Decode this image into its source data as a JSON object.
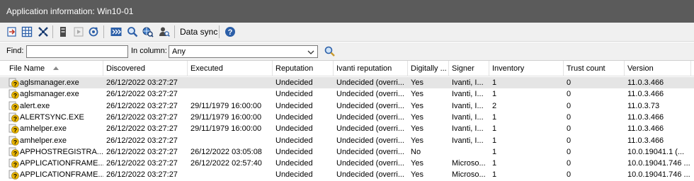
{
  "window": {
    "title": "Application information: Win10-01"
  },
  "toolbar": {
    "buttons": [
      {
        "icon": "export-icon"
      },
      {
        "icon": "grid-icon"
      },
      {
        "icon": "expand-icon"
      },
      {
        "icon": "device-icon"
      },
      {
        "icon": "play-icon"
      },
      {
        "icon": "refresh-icon"
      },
      {
        "icon": "forward-icon"
      },
      {
        "icon": "search-web-icon"
      },
      {
        "icon": "globe-search-icon"
      },
      {
        "icon": "user-search-icon"
      },
      {
        "icon": "help-icon"
      }
    ],
    "data_sync_label": "Data sync"
  },
  "findbar": {
    "find_label": "Find:",
    "find_value": "",
    "in_column_label": "In column:",
    "in_column_value": "Any"
  },
  "columns": [
    "File Name",
    "Discovered",
    "Executed",
    "Reputation",
    "Ivanti reputation",
    "Digitally ...",
    "Signer",
    "Inventory",
    "Trust count",
    "Version"
  ],
  "rows": [
    [
      "aglsmanager.exe",
      "26/12/2022 03:27:27",
      "",
      "Undecided",
      "Undecided (overri...",
      "Yes",
      "Ivanti, I...",
      "1",
      "0",
      "11.0.3.466"
    ],
    [
      "aglsmanager.exe",
      "26/12/2022 03:27:27",
      "",
      "Undecided",
      "Undecided (overri...",
      "Yes",
      "Ivanti, I...",
      "1",
      "0",
      "11.0.3.466"
    ],
    [
      "alert.exe",
      "26/12/2022 03:27:27",
      "29/11/1979 16:00:00",
      "Undecided",
      "Undecided (overri...",
      "Yes",
      "Ivanti, I...",
      "2",
      "0",
      "11.0.3.73"
    ],
    [
      "ALERTSYNC.EXE",
      "26/12/2022 03:27:27",
      "29/11/1979 16:00:00",
      "Undecided",
      "Undecided (overri...",
      "Yes",
      "Ivanti, I...",
      "1",
      "0",
      "11.0.3.466"
    ],
    [
      "amhelper.exe",
      "26/12/2022 03:27:27",
      "29/11/1979 16:00:00",
      "Undecided",
      "Undecided (overri...",
      "Yes",
      "Ivanti, I...",
      "1",
      "0",
      "11.0.3.466"
    ],
    [
      "amhelper.exe",
      "26/12/2022 03:27:27",
      "",
      "Undecided",
      "Undecided (overri...",
      "Yes",
      "Ivanti, I...",
      "1",
      "0",
      "11.0.3.466"
    ],
    [
      "APPHOSTREGISTRA...",
      "26/12/2022 03:27:27",
      "26/12/2022 03:05:08",
      "Undecided",
      "Undecided (overri...",
      "No",
      "",
      "1",
      "0",
      "10.0.19041.1 (..."
    ],
    [
      "APPLICATIONFRAME...",
      "26/12/2022 03:27:27",
      "26/12/2022 02:57:40",
      "Undecided",
      "Undecided (overri...",
      "Yes",
      "Microso...",
      "1",
      "0",
      "10.0.19041.746 ..."
    ],
    [
      "APPLICATIONFRAME...",
      "26/12/2022 03:27:27",
      "",
      "Undecided",
      "Undecided (overri...",
      "Yes",
      "Microso...",
      "1",
      "0",
      "10.0.19041.746 ..."
    ]
  ],
  "selected_row": 0,
  "colors": {
    "titlebar": "#5b5b5b",
    "selection": "#e5e5e5",
    "icon_blue": "#2c5fa8",
    "icon_warning": "#e8b400"
  }
}
